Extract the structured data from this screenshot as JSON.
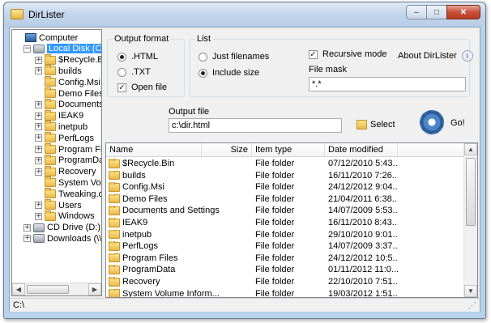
{
  "window": {
    "title": "DirLister",
    "buttons": {
      "minimize": "‒",
      "maximize": "□",
      "close": "✕"
    }
  },
  "tree": {
    "items": [
      {
        "label": "Computer",
        "icon": "computer-icon",
        "level": 0,
        "expander": ""
      },
      {
        "label": "Local Disk (C:)",
        "icon": "drive-icon",
        "level": 1,
        "expander": "−",
        "selected": true
      },
      {
        "label": "$Recycle.B",
        "icon": "folder-icon",
        "level": 2,
        "expander": "+"
      },
      {
        "label": "builds",
        "icon": "folder-icon",
        "level": 2,
        "expander": "+"
      },
      {
        "label": "Config.Msi",
        "icon": "folder-icon",
        "level": 2,
        "expander": ""
      },
      {
        "label": "Demo Files",
        "icon": "folder-icon",
        "level": 2,
        "expander": ""
      },
      {
        "label": "Documents",
        "icon": "folder-icon",
        "level": 2,
        "expander": "+"
      },
      {
        "label": "IEAK9",
        "icon": "folder-icon",
        "level": 2,
        "expander": "+"
      },
      {
        "label": "inetpub",
        "icon": "folder-icon",
        "level": 2,
        "expander": "+"
      },
      {
        "label": "PerfLogs",
        "icon": "folder-icon",
        "level": 2,
        "expander": "+"
      },
      {
        "label": "Program File",
        "icon": "folder-icon",
        "level": 2,
        "expander": "+"
      },
      {
        "label": "ProgramDat",
        "icon": "folder-icon",
        "level": 2,
        "expander": "+"
      },
      {
        "label": "Recovery",
        "icon": "folder-icon",
        "level": 2,
        "expander": "+"
      },
      {
        "label": "System Volu",
        "icon": "folder-icon",
        "level": 2,
        "expander": ""
      },
      {
        "label": "Tweaking.c",
        "icon": "folder-icon",
        "level": 2,
        "expander": ""
      },
      {
        "label": "Users",
        "icon": "folder-icon",
        "level": 2,
        "expander": "+"
      },
      {
        "label": "Windows",
        "icon": "folder-icon",
        "level": 2,
        "expander": "+"
      },
      {
        "label": "CD Drive (D:) V",
        "icon": "cd-drive-icon",
        "level": 1,
        "expander": "+"
      },
      {
        "label": "Downloads (\\\\w",
        "icon": "network-drive-icon",
        "level": 1,
        "expander": "+"
      }
    ]
  },
  "output_format": {
    "title": "Output format",
    "options": [
      {
        "label": ".HTML",
        "selected": true
      },
      {
        "label": ".TXT",
        "selected": false
      }
    ],
    "open_file": {
      "label": "Open file",
      "checked": true
    }
  },
  "list": {
    "title": "List",
    "options": [
      {
        "label": "Just filenames",
        "selected": false
      },
      {
        "label": "Include size",
        "selected": true
      }
    ],
    "recursive": {
      "label": "Recursive mode",
      "checked": true
    },
    "about": "About DirLister",
    "file_mask_label": "File mask",
    "file_mask_value": "*.*"
  },
  "output_file": {
    "label": "Output file",
    "value": "c:\\dir.html",
    "select_label": "Select",
    "go_label": "Go!"
  },
  "files": {
    "columns": [
      "Name",
      "Size",
      "Item type",
      "Date modified"
    ],
    "rows": [
      {
        "name": "$Recycle.Bin",
        "size": "",
        "type": "File folder",
        "date": "07/12/2010 5:43..."
      },
      {
        "name": "builds",
        "size": "",
        "type": "File folder",
        "date": "16/11/2010 7:26..."
      },
      {
        "name": "Config.Msi",
        "size": "",
        "type": "File folder",
        "date": "24/12/2012 9:04..."
      },
      {
        "name": "Demo Files",
        "size": "",
        "type": "File folder",
        "date": "21/04/2011 6:38..."
      },
      {
        "name": "Documents and Settings",
        "size": "",
        "type": "File folder",
        "date": "14/07/2009 5:53..."
      },
      {
        "name": "IEAK9",
        "size": "",
        "type": "File folder",
        "date": "16/11/2010 8:43..."
      },
      {
        "name": "inetpub",
        "size": "",
        "type": "File folder",
        "date": "29/10/2010 9:01..."
      },
      {
        "name": "PerfLogs",
        "size": "",
        "type": "File folder",
        "date": "14/07/2009 3:37..."
      },
      {
        "name": "Program Files",
        "size": "",
        "type": "File folder",
        "date": "24/12/2012 10:5..."
      },
      {
        "name": "ProgramData",
        "size": "",
        "type": "File folder",
        "date": "01/11/2012 11:0..."
      },
      {
        "name": "Recovery",
        "size": "",
        "type": "File folder",
        "date": "22/10/2010 7:51..."
      },
      {
        "name": "System Volume Inform...",
        "size": "",
        "type": "File folder",
        "date": "19/03/2012 1:51..."
      }
    ]
  },
  "status": {
    "path": "C:\\"
  }
}
